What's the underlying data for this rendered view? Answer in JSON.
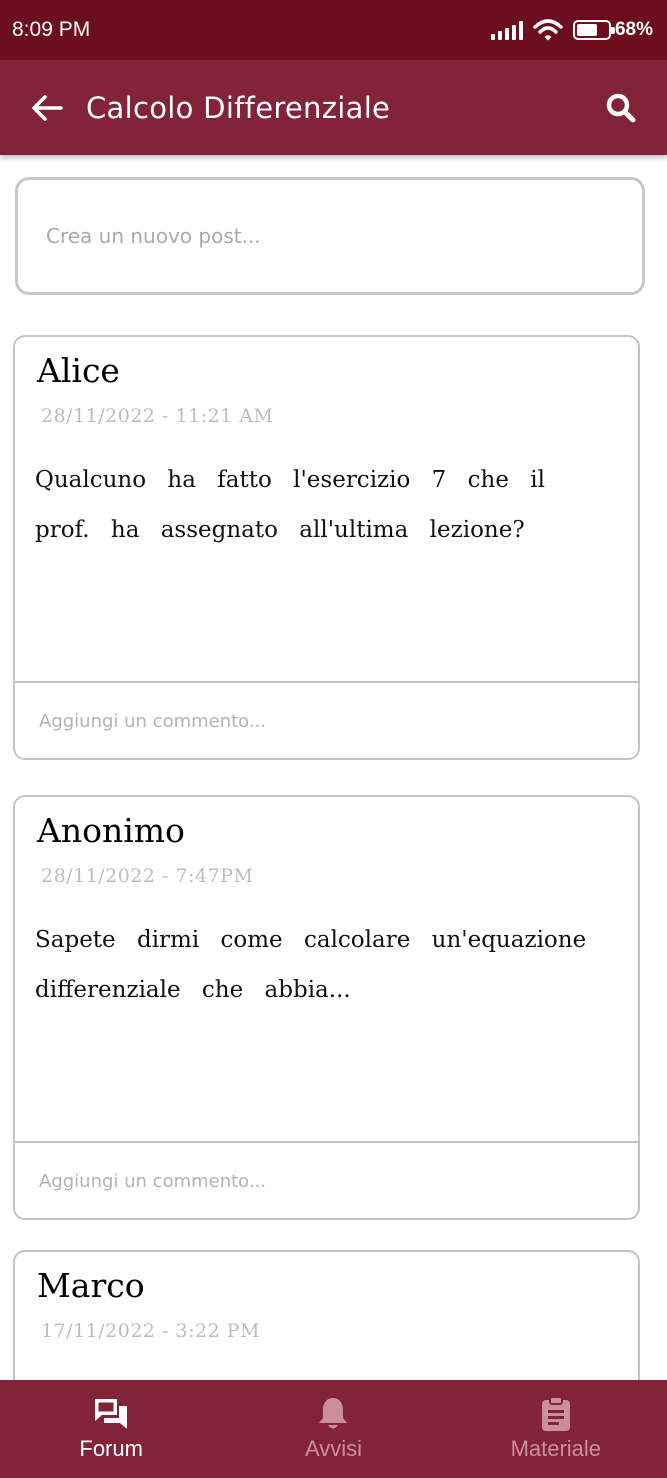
{
  "status_bar": {
    "time": "8:09 PM",
    "battery_percent": "68%",
    "battery_level": 0.68,
    "icons": [
      "signal-icon",
      "wifi-icon",
      "battery-icon"
    ]
  },
  "app_bar": {
    "title": "Calcolo Differenziale",
    "back_icon": "arrow-left-icon",
    "search_icon": "search-icon"
  },
  "new_post": {
    "placeholder": "Crea un nuovo post..."
  },
  "posts": [
    {
      "author": "Alice",
      "date": "28/11/2022 - 11:21 AM",
      "body": "Qualcuno ha fatto l'esercizio 7 che il prof. ha assegnato all'ultima lezione?",
      "comment_placeholder": "Aggiungi un commento..."
    },
    {
      "author": "Anonimo",
      "date": "28/11/2022 - 7:47PM",
      "body": "Sapete dirmi come calcolare un'equazione differenziale che abbia...",
      "comment_placeholder": "Aggiungi un commento..."
    },
    {
      "author": "Marco",
      "date": "17/11/2022 - 3:22 PM",
      "body": "",
      "comment_placeholder": ""
    }
  ],
  "bottom_nav": {
    "items": [
      {
        "label": "Forum",
        "icon": "forum-icon",
        "active": true
      },
      {
        "label": "Avvisi",
        "icon": "bell-icon",
        "active": false
      },
      {
        "label": "Materiale",
        "icon": "clipboard-icon",
        "active": false
      }
    ]
  },
  "colors": {
    "status_bar": "#6b0f1e",
    "primary": "#832337",
    "nav_inactive": "#c9909b",
    "border": "#c4c4c4"
  }
}
